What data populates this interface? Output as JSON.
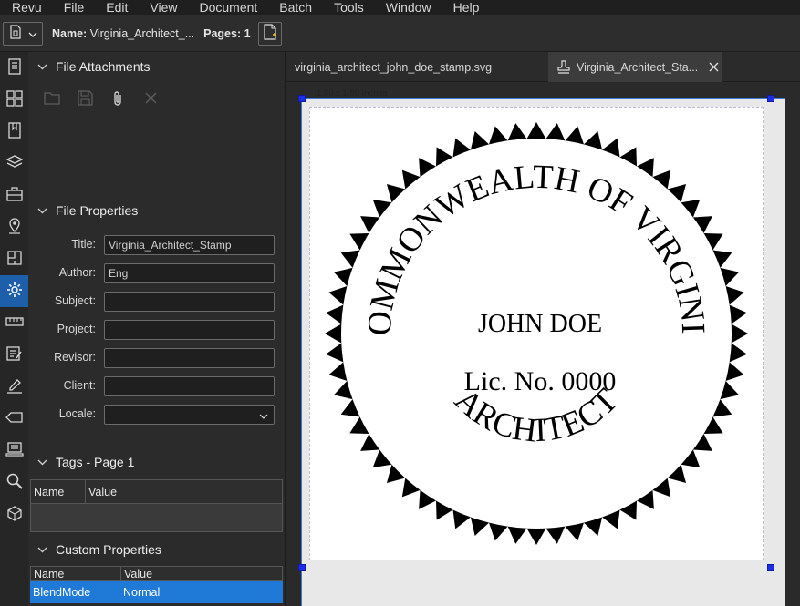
{
  "menu": [
    "Revu",
    "File",
    "Edit",
    "View",
    "Document",
    "Batch",
    "Tools",
    "Window",
    "Help"
  ],
  "toolbar": {
    "name_label": "Name:",
    "name_value": "Virginia_Architect_...",
    "pages_label": "Pages:",
    "pages_value": "1"
  },
  "sidebar_icons": [
    "thumbnails-icon",
    "grid-icon",
    "bookmarks-icon",
    "layers-icon",
    "toolchest-icon",
    "places-icon",
    "spaces-icon",
    "properties-icon",
    "measure-icon",
    "markups-list-icon",
    "signatures-icon",
    "tags-icon",
    "forms-icon",
    "search-icon",
    "3d-icon"
  ],
  "active_icon": "properties-icon",
  "panel": {
    "attachments_title": "File Attachments",
    "file_properties_title": "File Properties",
    "properties": [
      {
        "label": "Title:",
        "value": "Virginia_Architect_Stamp"
      },
      {
        "label": "Author:",
        "value": "Eng"
      },
      {
        "label": "Subject:",
        "value": ""
      },
      {
        "label": "Project:",
        "value": ""
      },
      {
        "label": "Revisor:",
        "value": ""
      },
      {
        "label": "Client:",
        "value": ""
      },
      {
        "label": "Locale:",
        "value": ""
      }
    ],
    "tags_title": "Tags - Page 1",
    "tags_columns": [
      "Name",
      "Value"
    ],
    "custom_title": "Custom Properties",
    "custom_columns": [
      "Name",
      "Value"
    ],
    "custom_rows": [
      {
        "name": "BlendMode",
        "value": "Normal"
      }
    ]
  },
  "tabs": [
    {
      "label": "virginia_architect_john_doe_stamp.svg"
    },
    {
      "label": "Virginia_Architect_Sta..."
    }
  ],
  "canvas": {
    "dimension_label": "1.99 x 1.99 Inches"
  },
  "stamp": {
    "top_text": "COMMONWEALTH OF VIRGINIA",
    "bottom_text": "ARCHITECT",
    "name": "JOHN DOE",
    "license": "Lic. No. 0000"
  },
  "colors": {
    "accent": "#1d5fa8",
    "selection_row": "#1e7ad6",
    "handle": "#1b2ee8"
  }
}
